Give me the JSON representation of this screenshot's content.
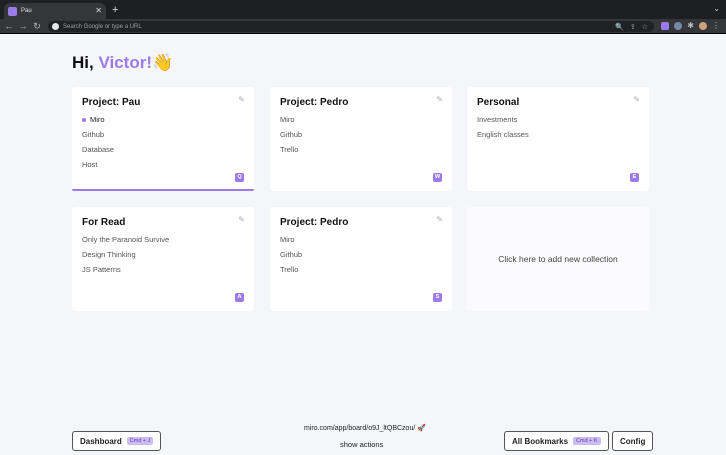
{
  "browser": {
    "tab_title": "Pau",
    "tab_close": "✕",
    "new_tab": "+",
    "tab_menu": "⌄",
    "back": "←",
    "forward": "→",
    "reload": "↻",
    "omnibox_placeholder": "Search Google or type a URL",
    "omni_icons": [
      "🔍",
      "⇪",
      "☆"
    ],
    "ext_puzzle": "✱",
    "ext_dots": "⋮"
  },
  "greeting": {
    "prefix": "Hi, ",
    "name": "Victor!",
    "emoji": "👋"
  },
  "collections": [
    {
      "title": "Project: Pau",
      "links": [
        "Miro",
        "Github",
        "Database",
        "Host"
      ],
      "active_link": 0,
      "shortcut": "Q",
      "active": true
    },
    {
      "title": "Project: Pedro",
      "links": [
        "Miro",
        "Github",
        "Trello"
      ],
      "shortcut": "W"
    },
    {
      "title": "Personal",
      "links": [
        "Investments",
        "English classes"
      ],
      "shortcut": "E"
    },
    {
      "title": "For Read",
      "links": [
        "Only the Paranoid Survive",
        "Design Thinking",
        "JS Patterns"
      ],
      "shortcut": "A"
    },
    {
      "title": "Project: Pedro",
      "links": [
        "Miro",
        "Github",
        "Trello"
      ],
      "shortcut": "S"
    }
  ],
  "edit_icon": "✎",
  "add_collection": "Click here to add new collection",
  "footer": {
    "dashboard_label": "Dashboard",
    "dashboard_kbd": "Cmd + J",
    "url": "miro.com/app/board/o9J_ltQBCzou/",
    "url_emoji": "🚀",
    "actions": "show actions",
    "bookmarks_label": "All Bookmarks",
    "bookmarks_kbd": "Cmd + K",
    "config_label": "Config"
  },
  "colors": {
    "accent": "#9b7bea",
    "background": "#f5f6fa"
  }
}
